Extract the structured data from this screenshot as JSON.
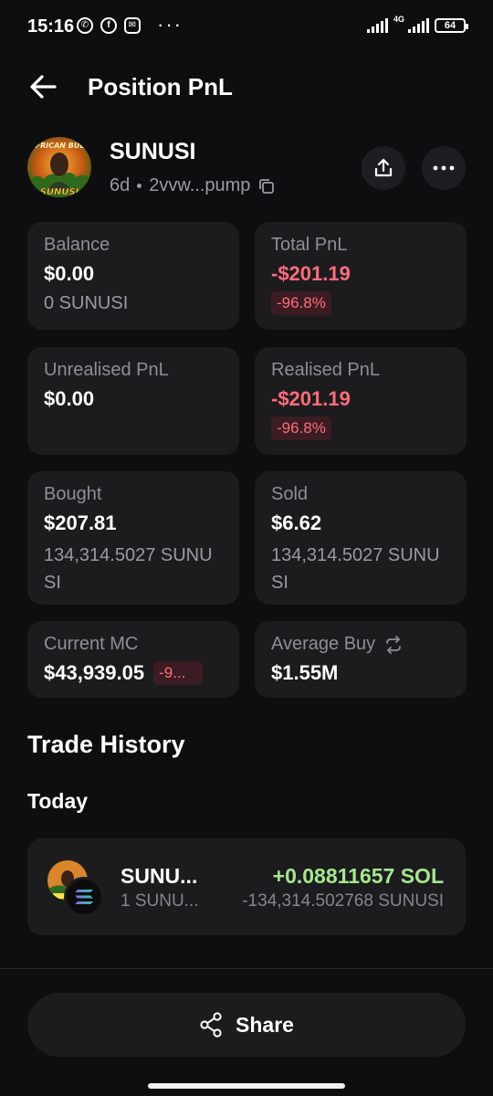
{
  "status_bar": {
    "time": "15:16",
    "network": "4G",
    "battery": "64",
    "more": "···"
  },
  "header": {
    "title": "Position PnL"
  },
  "token": {
    "name": "SUNUSI",
    "age": "6d",
    "address": "2vvw...pump",
    "logo_text_top": "AFRICAN BULL",
    "logo_text_bottom": "SUNUSI"
  },
  "stats": {
    "balance": {
      "label": "Balance",
      "value": "$0.00",
      "sub": "0 SUNUSI"
    },
    "total_pnl": {
      "label": "Total PnL",
      "value": "-$201.19",
      "badge": "-96.8%"
    },
    "unrealised_pnl": {
      "label": "Unrealised PnL",
      "value": "$0.00"
    },
    "realised_pnl": {
      "label": "Realised PnL",
      "value": "-$201.19",
      "badge": "-96.8%"
    },
    "bought": {
      "label": "Bought",
      "value": "$207.81",
      "sub": "134,314.5027 SUNUSI"
    },
    "sold": {
      "label": "Sold",
      "value": "$6.62",
      "sub": "134,314.5027 SUNUSI"
    },
    "current_mc": {
      "label": "Current MC",
      "value": "$43,939.05",
      "badge": "-9..."
    },
    "average_buy": {
      "label": "Average Buy",
      "value": "$1.55M"
    }
  },
  "trade_history": {
    "title": "Trade History",
    "groups": [
      {
        "day": "Today",
        "trades": [
          {
            "name": "SUNU...",
            "qty": "1 SUNU...",
            "amount": "+0.08811657 SOL",
            "tokens": "-134,314.502768 SUNUSI"
          }
        ]
      }
    ]
  },
  "share": {
    "label": "Share"
  },
  "colors": {
    "background": "#0e0e10",
    "card": "#1c1c1f",
    "negative": "#ff6c7b",
    "positive": "#a4e88a"
  }
}
